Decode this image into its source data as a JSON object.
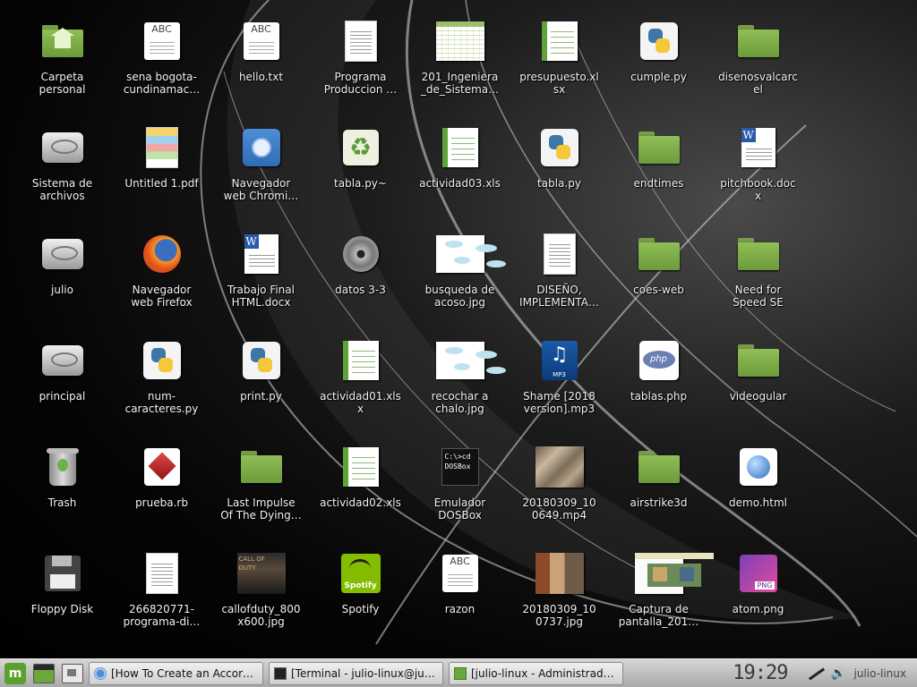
{
  "desktop": {
    "icons": [
      {
        "label": "Carpeta\npersonal",
        "kind": "home-folder"
      },
      {
        "label": "sena bogota-\ncundinamac…",
        "kind": "abc"
      },
      {
        "label": "hello.txt",
        "kind": "abc"
      },
      {
        "label": "Programa\nProduccion …",
        "kind": "doc"
      },
      {
        "label": "201_Ingeniera\n_de_Sistema…",
        "kind": "thumb-table"
      },
      {
        "label": "presupuesto.xl\nsx",
        "kind": "sheet"
      },
      {
        "label": "cumple.py",
        "kind": "py"
      },
      {
        "label": "disenosvalcarc\nel",
        "kind": "folder"
      },
      {
        "label": "Sistema de\narchivos",
        "kind": "drive"
      },
      {
        "label": "Untitled 1.pdf",
        "kind": "doc-color"
      },
      {
        "label": "Navegador\nweb Chromi…",
        "kind": "chromium"
      },
      {
        "label": "tabla.py~",
        "kind": "recycle"
      },
      {
        "label": "actividad03.xls",
        "kind": "sheet"
      },
      {
        "label": "tabla.py",
        "kind": "py"
      },
      {
        "label": "endtimes",
        "kind": "folder"
      },
      {
        "label": "pitchbook.doc\nx",
        "kind": "word"
      },
      {
        "label": "julio",
        "kind": "drive"
      },
      {
        "label": "Navegador\nweb Firefox",
        "kind": "firefox"
      },
      {
        "label": "Trabajo Final\nHTML.docx",
        "kind": "word"
      },
      {
        "label": "datos 3-3",
        "kind": "cd"
      },
      {
        "label": "busqueda de\nacoso.jpg",
        "kind": "thumb-diagram"
      },
      {
        "label": "DISEÑO,\nIMPLEMENTA…",
        "kind": "doc"
      },
      {
        "label": "coes-web",
        "kind": "folder"
      },
      {
        "label": "Need for\nSpeed SE",
        "kind": "folder"
      },
      {
        "label": "principal",
        "kind": "drive"
      },
      {
        "label": "num-\ncaracteres.py",
        "kind": "py"
      },
      {
        "label": "print.py",
        "kind": "py"
      },
      {
        "label": "actividad01.xls\nx",
        "kind": "sheet"
      },
      {
        "label": "recochar a\nchalo.jpg",
        "kind": "thumb-diagram"
      },
      {
        "label": "Shame [2018\nversion].mp3",
        "kind": "music"
      },
      {
        "label": "tablas.php",
        "kind": "php"
      },
      {
        "label": "videogular",
        "kind": "folder"
      },
      {
        "label": "Trash",
        "kind": "trash"
      },
      {
        "label": "prueba.rb",
        "kind": "ruby"
      },
      {
        "label": "Last Impulse\nOf The Dying…",
        "kind": "folder"
      },
      {
        "label": "actividad02.xls",
        "kind": "sheet"
      },
      {
        "label": "Emulador\nDOSBox",
        "kind": "dosbox"
      },
      {
        "label": "20180309_10\n0649.mp4",
        "kind": "thumb-photo"
      },
      {
        "label": "airstrike3d",
        "kind": "folder"
      },
      {
        "label": "demo.html",
        "kind": "globe"
      },
      {
        "label": "Floppy Disk",
        "kind": "floppy"
      },
      {
        "label": "266820771-\nprograma-di…",
        "kind": "doc"
      },
      {
        "label": "callofduty_800\nx600.jpg",
        "kind": "thumb-game"
      },
      {
        "label": "Spotify",
        "kind": "spotify"
      },
      {
        "label": "razon",
        "kind": "abc"
      },
      {
        "label": "20180309_10\n0737.jpg",
        "kind": "thumb-photo2"
      },
      {
        "label": "Captura de\npantalla_201…",
        "kind": "thumb-screen"
      },
      {
        "label": "atom.png",
        "kind": "png"
      }
    ],
    "glyph_text": {
      "abc": "ABC",
      "word": "W",
      "dos_line1": "C:\\>cd",
      "dos_line2": "DOSBox",
      "mp3": "MP3",
      "php": "php",
      "png": "PNG",
      "spotify": "Spotify",
      "game": "CALL OF DUTY"
    }
  },
  "panel": {
    "menu_label": "m",
    "tasks": [
      {
        "title": "[How To Create an Accordi…",
        "icon": "chromium-icon"
      },
      {
        "title": "[Terminal - julio-linux@juli…",
        "icon": "terminal-icon"
      },
      {
        "title": "[julio-linux - Administrado…",
        "icon": "disk-icon"
      }
    ],
    "clock": "19:29",
    "username": "julio-linux"
  }
}
